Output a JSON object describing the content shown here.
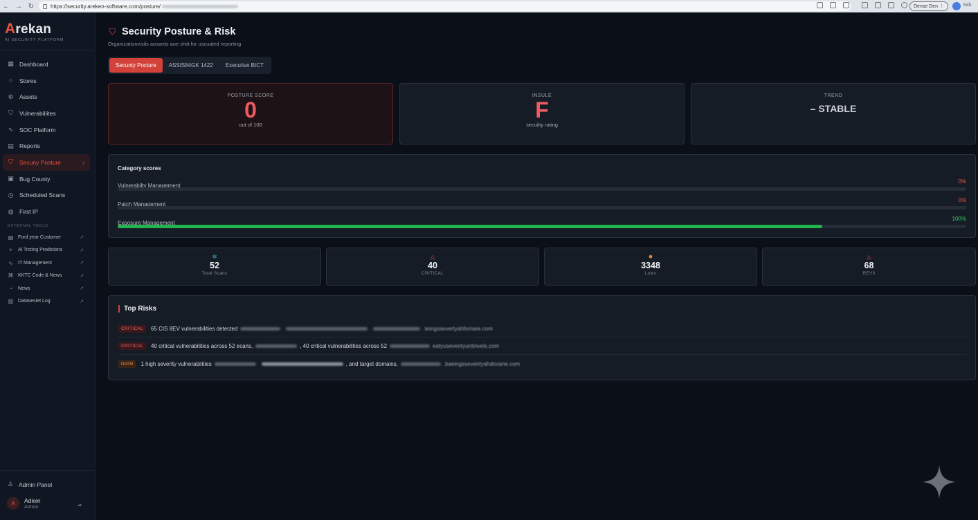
{
  "browser": {
    "url": "https://security.areken-software.com/posture/",
    "profile_label": "Dense Den",
    "sync_label": "Sab"
  },
  "brand": {
    "logo_letter": "A",
    "name_rest": "rekan",
    "tagline": "AI SECURITY PLATFORM"
  },
  "sidebar": {
    "items": [
      {
        "label": "Dashboard",
        "icon": "grid-icon"
      },
      {
        "label": "Stores",
        "icon": "search-icon"
      },
      {
        "label": "Assets",
        "icon": "gear-icon"
      },
      {
        "label": "Vulnerabiliites",
        "icon": "shield-icon"
      },
      {
        "label": "SOC Platform",
        "icon": "activity-icon"
      },
      {
        "label": "Reports",
        "icon": "document-icon"
      },
      {
        "label": "Secuny Posture",
        "icon": "shield-icon",
        "active": true
      },
      {
        "label": "Bug County",
        "icon": "bug-icon"
      },
      {
        "label": "Scheduled Scans",
        "icon": "clock-icon"
      },
      {
        "label": "First IP",
        "icon": "globe-icon"
      }
    ],
    "external_heading": "EXTERNAL TOOLS",
    "external": [
      {
        "label": "Ford year Customer",
        "icon": "list-icon"
      },
      {
        "label": "Al Trcting Prodstions",
        "icon": "sparkle-icon"
      },
      {
        "label": "IT Management",
        "icon": "activity-icon"
      },
      {
        "label": "KKTC Code & News",
        "icon": "code-icon"
      },
      {
        "label": "News",
        "icon": "rss-icon"
      },
      {
        "label": "Datasesiet Log",
        "icon": "document-icon"
      }
    ],
    "admin_panel": "Admin Panel",
    "user": {
      "initial": "A",
      "name": "Adioin",
      "role": "Aonun"
    }
  },
  "page": {
    "title": "Security Posture & Risk",
    "subtitle": "Organizationvisils aosards aoe shiit for uscualed reporting",
    "tabs": [
      "Secunty Pocture",
      "ASSIS84GK 1422",
      "Executive BICT"
    ]
  },
  "score_cards": [
    {
      "label": "POSTURE SCORE",
      "value": "0",
      "sub": "out of 100"
    },
    {
      "label": "INSULE",
      "value": "F",
      "sub": "secuilty rating"
    },
    {
      "label": "TREND",
      "value": "– STABLE"
    }
  ],
  "categories": {
    "title": "Category scores",
    "rows": [
      {
        "name": "Vulnerabilty Management",
        "pct_label": "0%",
        "pct": 0,
        "color": "#e8554a"
      },
      {
        "name": "Patch Management",
        "pct_label": "0%",
        "pct": 0,
        "color": "#e8554a"
      },
      {
        "name": "Exposure Management",
        "pct_label": "100%",
        "pct": 0.83,
        "color": "#2bd05a"
      }
    ]
  },
  "stats": [
    {
      "value": "52",
      "label": "Total Scans",
      "icon": "network-icon",
      "color": "#3ab0c8"
    },
    {
      "value": "40",
      "label": "CRITICAL",
      "icon": "warning-icon",
      "color": "#e8554a"
    },
    {
      "value": "3348",
      "label": "Lows",
      "icon": "bug-icon",
      "color": "#e58e4f"
    },
    {
      "value": "68",
      "label": "REY3",
      "icon": "warning-icon",
      "color": "#e8554a"
    }
  ],
  "risks": {
    "title": "Top Risks",
    "items": [
      {
        "severity": "CRITICAL",
        "text_a": "65 CIS 8EV vulnerabilities detected",
        "text_b": "",
        "text_c": ".teingssevertyahfomare.com"
      },
      {
        "severity": "CRITICAL",
        "text_a": "40 critical vulnerabilities across 52 ecans,",
        "text_b": ", 40 critical vulnerabilities across 52",
        "text_c": "eatyuseventyuntinvels.com"
      },
      {
        "severity": "NIGN",
        "text_a": "1 high severity vulnerabilities",
        "text_b": ", and target domains,",
        "text_c": ".baeingsseventyahdovane.com"
      }
    ]
  }
}
